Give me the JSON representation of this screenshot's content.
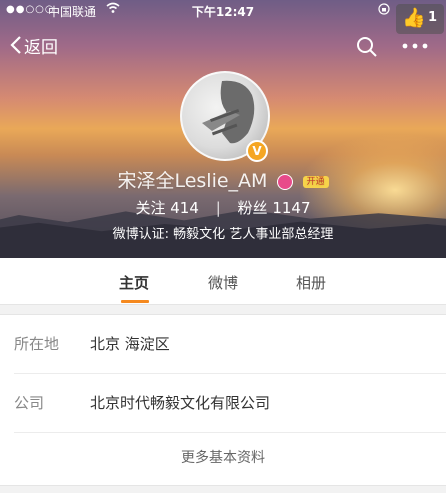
{
  "status_bar": {
    "signal": "●●○○○",
    "carrier": "中国联通",
    "wifi_icon": "wifi-icon",
    "time": "下午12:47",
    "lock_icon": "rotation-lock-icon"
  },
  "like_badge": {
    "icon": "thumbs-up-icon",
    "count": "1"
  },
  "nav": {
    "back_label": "返回",
    "back_icon": "chevron-left-icon",
    "search_icon": "search-icon",
    "more_icon": "more-dots-icon"
  },
  "profile": {
    "name": "宋泽全Leslie_AM",
    "vip_badge": "开通",
    "following_label": "关注",
    "following_count": "414",
    "separator": "|",
    "followers_label": "粉丝",
    "followers_count": "1147",
    "verification": "微博认证: 畅毅文化 艺人事业部总经理",
    "verified_icon": "verified-v-icon"
  },
  "tabs": [
    {
      "label": "主页",
      "active": true
    },
    {
      "label": "微博",
      "active": false
    },
    {
      "label": "相册",
      "active": false
    }
  ],
  "info": {
    "location_label": "所在地",
    "location_value": "北京 海淀区",
    "company_label": "公司",
    "company_value": "北京时代畅毅文化有限公司",
    "more_label": "更多基本资料"
  },
  "colors": {
    "accent": "#f5891f",
    "verified": "#f5a623"
  }
}
